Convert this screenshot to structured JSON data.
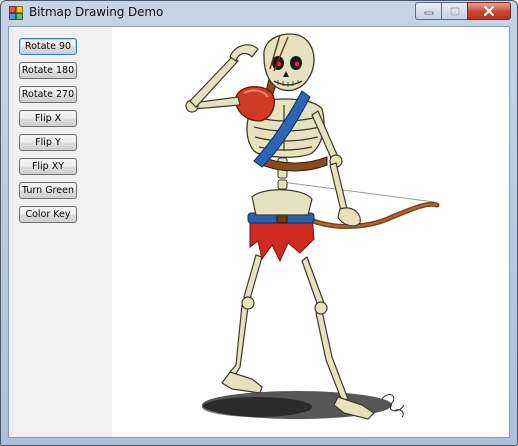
{
  "window": {
    "title": "Bitmap Drawing Demo",
    "icon": "app-icon",
    "controls": [
      "minimize-icon",
      "maximize-icon",
      "close-icon"
    ]
  },
  "buttons": [
    {
      "label": "Rotate 90",
      "name": "rotate-90-button"
    },
    {
      "label": "Rotate 180",
      "name": "rotate-180-button"
    },
    {
      "label": "Rotate 270",
      "name": "rotate-270-button"
    },
    {
      "label": "Flip X",
      "name": "flip-x-button"
    },
    {
      "label": "Flip Y",
      "name": "flip-y-button"
    },
    {
      "label": "Flip XY",
      "name": "flip-xy-button"
    },
    {
      "label": "Turn Green",
      "name": "turn-green-button"
    },
    {
      "label": "Color Key",
      "name": "color-key-button"
    }
  ],
  "colors": {
    "titlebar": "#b9c9df",
    "panel": "#f0f0f0",
    "canvas": "#ffffff",
    "bone": "#e6e2bf",
    "strap_blue": "#2d66b0",
    "shoulder_red": "#d03a24",
    "bow_brown": "#8a4b1e"
  }
}
